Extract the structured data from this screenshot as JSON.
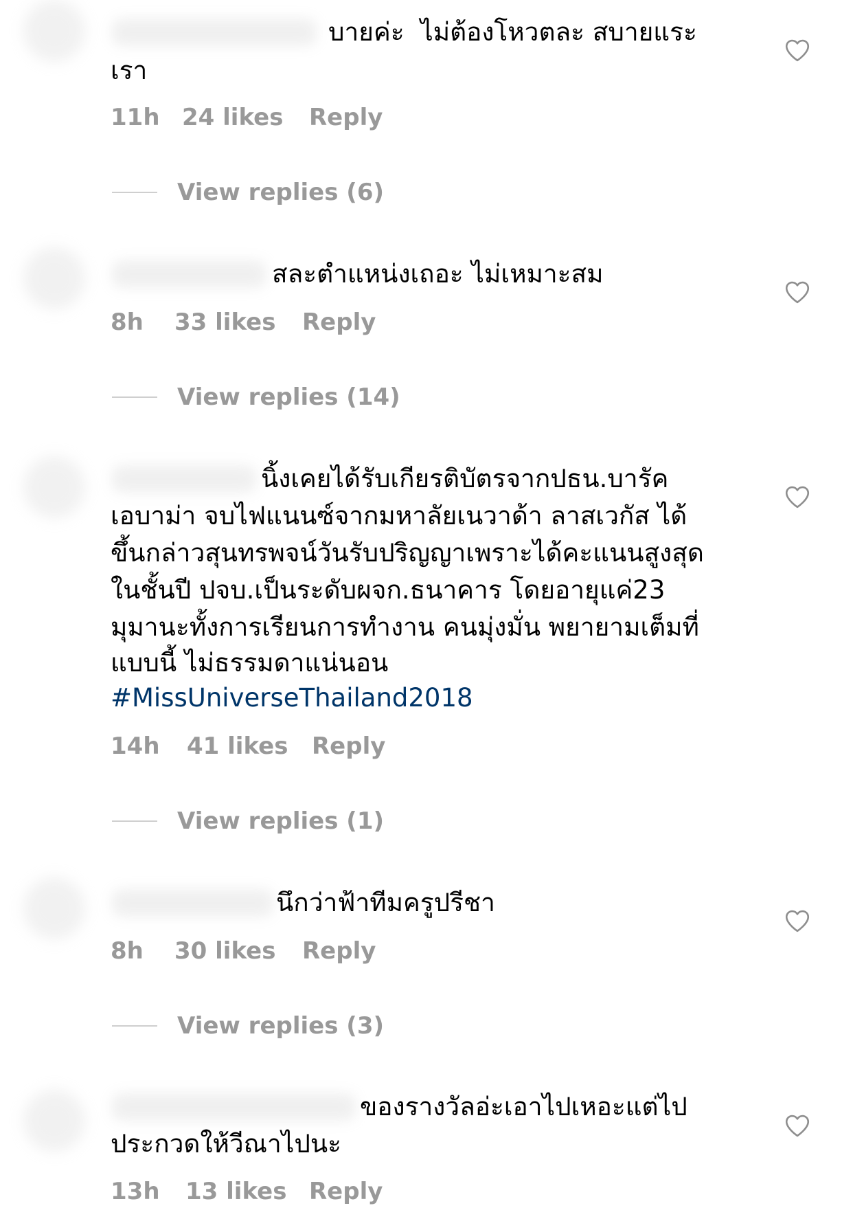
{
  "colors": {
    "text": "#000000",
    "meta": "#999999",
    "hashtag": "#003569",
    "icon": "#8e8e8e"
  },
  "comments": [
    {
      "text_lines": [
        "บายค่ะ  ไม่ต้องโหวตละ สบายแระ",
        "เรา"
      ],
      "time": "11h",
      "likes": "24 likes",
      "reply_label": "Reply",
      "view_replies": "View replies (6)",
      "like_icon": "heart-outline-icon"
    },
    {
      "text_lines": [
        "สละตำแหน่งเถอะ ไม่เหมาะสม"
      ],
      "time": "8h",
      "likes": "33 likes",
      "reply_label": "Reply",
      "view_replies": "View replies (14)",
      "like_icon": "heart-outline-icon"
    },
    {
      "text_lines": [
        "นิ้งเคยได้รับเกียรติบัตรจากปธน.บารัค",
        "เอบาม่า จบไฟแนนซ์จากมหาลัยเนวาด้า ลาสเวกัส ได้",
        "ขึ้นกล่าวสุนทรพจน์วันรับปริญญาเพราะได้คะแนนสูงสุด",
        "ในชั้นปี ปจบ.เป็นระดับผจก.ธนาคาร โดยอายุแค่23",
        "มุมานะทั้งการเรียนการทำงาน คนมุ่งมั่น พยายามเต็มที่",
        "แบบนี้ ไม่ธรรมดาแน่นอน"
      ],
      "hashtag": "#MissUniverseThailand2018",
      "time": "14h",
      "likes": "41 likes",
      "reply_label": "Reply",
      "view_replies": "View replies (1)",
      "like_icon": "heart-outline-icon"
    },
    {
      "text_lines": [
        "นึกว่าฟ้าทีมครูปรีชา"
      ],
      "time": "8h",
      "likes": "30 likes",
      "reply_label": "Reply",
      "view_replies": "View replies (3)",
      "like_icon": "heart-outline-icon"
    },
    {
      "text_lines": [
        "ของรางวัลอ่ะเอาไปเหอะแต่ไป",
        "ประกวดให้วีณาไปนะ"
      ],
      "time": "13h",
      "likes": "13 likes",
      "reply_label": "Reply",
      "like_icon": "heart-outline-icon"
    }
  ]
}
